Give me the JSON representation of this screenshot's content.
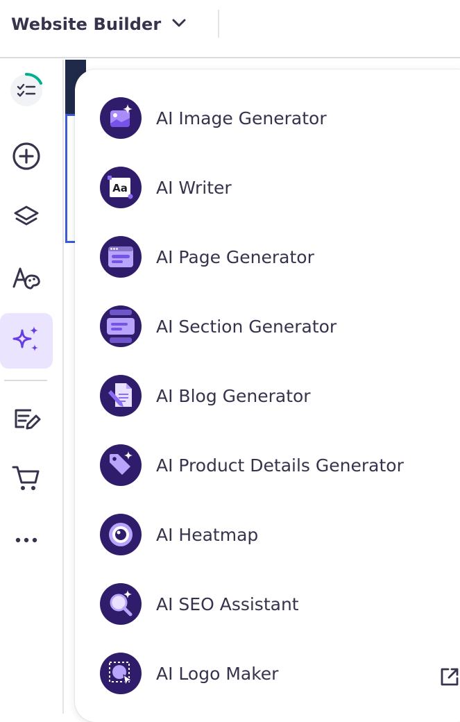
{
  "header": {
    "app_title": "Website Builder",
    "dropdown_icon": "chevron-down-icon"
  },
  "sidebar": {
    "items": [
      {
        "name": "checklist",
        "icon": "checklist-progress-icon"
      },
      {
        "name": "add",
        "icon": "plus-circle-icon"
      },
      {
        "name": "layers",
        "icon": "layers-icon"
      },
      {
        "name": "styles",
        "icon": "typography-palette-icon"
      },
      {
        "name": "ai-tools",
        "icon": "sparkles-icon",
        "active": true
      },
      {
        "name": "blog",
        "icon": "edit-list-icon"
      },
      {
        "name": "store",
        "icon": "cart-icon"
      },
      {
        "name": "more",
        "icon": "more-horizontal-icon"
      }
    ]
  },
  "ai_menu": {
    "items": [
      {
        "label": "AI Image Generator",
        "icon": "ai-image-icon"
      },
      {
        "label": "AI Writer",
        "icon": "ai-writer-icon"
      },
      {
        "label": "AI Page Generator",
        "icon": "ai-page-icon"
      },
      {
        "label": "AI Section Generator",
        "icon": "ai-section-icon"
      },
      {
        "label": "AI Blog Generator",
        "icon": "ai-blog-icon"
      },
      {
        "label": "AI Product Details Generator",
        "icon": "ai-product-tag-icon"
      },
      {
        "label": "AI Heatmap",
        "icon": "ai-heatmap-eye-icon"
      },
      {
        "label": "AI SEO Assistant",
        "icon": "ai-seo-magnifier-icon"
      },
      {
        "label": "AI Logo Maker",
        "icon": "ai-logo-icon",
        "external": true
      }
    ]
  },
  "colors": {
    "brand_dark": "#2f1c6a",
    "brand_accent": "#8c6cf5",
    "active_bg": "#ebe4ff",
    "text": "#36344d",
    "progress": "#00b090"
  }
}
